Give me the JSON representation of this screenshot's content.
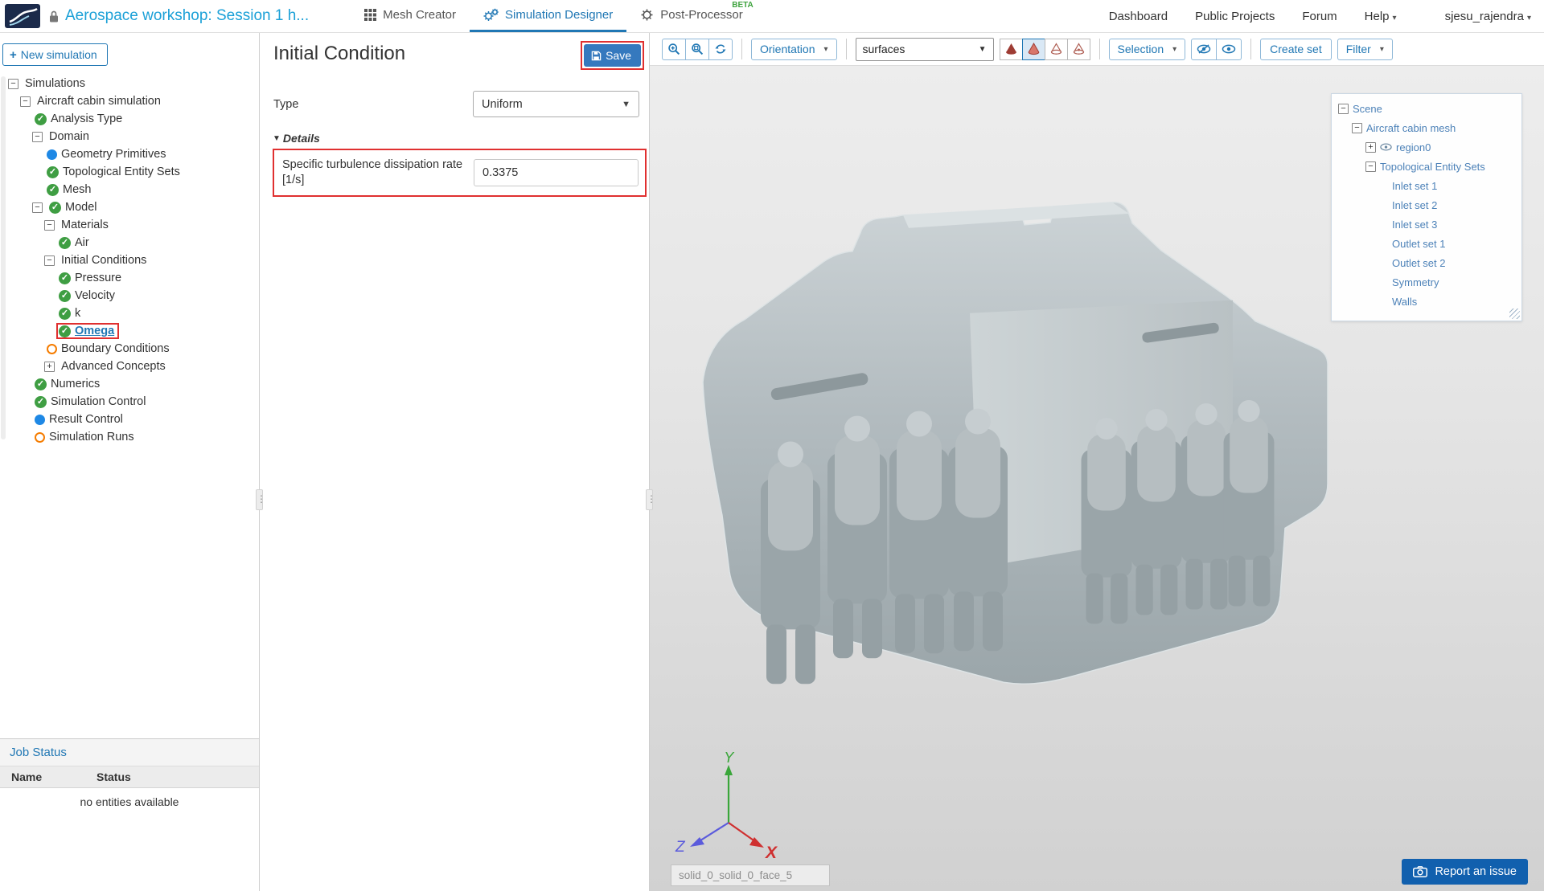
{
  "header": {
    "project_title": "Aerospace workshop: Session 1 h...",
    "tabs": [
      {
        "label": "Mesh Creator",
        "icon": "grid-icon",
        "active": false
      },
      {
        "label": "Simulation Designer",
        "icon": "gears-icon",
        "active": true
      },
      {
        "label": "Post-Processor",
        "icon": "gear-icon",
        "active": false,
        "badge": "BETA"
      }
    ],
    "nav_links": [
      "Dashboard",
      "Public Projects",
      "Forum"
    ],
    "help_label": "Help",
    "user_name": "sjesu_rajendra"
  },
  "sidebar": {
    "new_simulation_label": "New simulation",
    "tree": [
      {
        "label": "Simulations",
        "level": 0,
        "toggle": "minus"
      },
      {
        "label": "Aircraft cabin simulation",
        "level": 1,
        "toggle": "minus"
      },
      {
        "label": "Analysis Type",
        "level": 2,
        "status": "check"
      },
      {
        "label": "Domain",
        "level": 2,
        "toggle": "minus"
      },
      {
        "label": "Geometry Primitives",
        "level": 3,
        "status": "blue"
      },
      {
        "label": "Topological Entity Sets",
        "level": 3,
        "status": "check"
      },
      {
        "label": "Mesh",
        "level": 3,
        "status": "check"
      },
      {
        "label": "Model",
        "level": 2,
        "toggle": "minus",
        "status": "check"
      },
      {
        "label": "Materials",
        "level": 3,
        "toggle": "minus"
      },
      {
        "label": "Air",
        "level": 4,
        "status": "check"
      },
      {
        "label": "Initial Conditions",
        "level": 3,
        "toggle": "minus"
      },
      {
        "label": "Pressure",
        "level": 4,
        "status": "check"
      },
      {
        "label": "Velocity",
        "level": 4,
        "status": "check"
      },
      {
        "label": "k",
        "level": 4,
        "status": "check"
      },
      {
        "label": "Omega",
        "level": 4,
        "status": "check",
        "selected": true
      },
      {
        "label": "Boundary Conditions",
        "level": 3,
        "status": "orange"
      },
      {
        "label": "Advanced Concepts",
        "level": 3,
        "toggle": "plus"
      },
      {
        "label": "Numerics",
        "level": 2,
        "status": "check"
      },
      {
        "label": "Simulation Control",
        "level": 2,
        "status": "check"
      },
      {
        "label": "Result Control",
        "level": 2,
        "status": "blue"
      },
      {
        "label": "Simulation Runs",
        "level": 2,
        "status": "orange"
      }
    ],
    "job_status": {
      "title": "Job Status",
      "columns": [
        "Name",
        "Status"
      ],
      "empty_message": "no entities available"
    }
  },
  "panel": {
    "title": "Initial Condition",
    "save_label": "Save",
    "type_label": "Type",
    "type_value": "Uniform",
    "details_label": "Details",
    "field_label": "Specific turbulence dissipation rate [1/s]",
    "field_value": "0.3375"
  },
  "viewport": {
    "toolbar": {
      "orientation_label": "Orientation",
      "surfaces_value": "surfaces",
      "selection_label": "Selection",
      "create_set_label": "Create set",
      "filter_label": "Filter"
    },
    "scene_tree": [
      {
        "label": "Scene",
        "level": 0,
        "toggle": "minus"
      },
      {
        "label": "Aircraft cabin mesh",
        "level": 1,
        "toggle": "minus"
      },
      {
        "label": "region0",
        "level": 2,
        "toggle": "plus",
        "eye": true
      },
      {
        "label": "Topological Entity Sets",
        "level": 2,
        "toggle": "minus"
      },
      {
        "label": "Inlet set 1",
        "level": 3
      },
      {
        "label": "Inlet set 2",
        "level": 3
      },
      {
        "label": "Inlet set 3",
        "level": 3
      },
      {
        "label": "Outlet set 1",
        "level": 3
      },
      {
        "label": "Outlet set 2",
        "level": 3
      },
      {
        "label": "Symmetry",
        "level": 3
      },
      {
        "label": "Walls",
        "level": 3
      }
    ],
    "axis_labels": {
      "x": "X",
      "y": "Y",
      "z": "Z"
    },
    "face_field_value": "solid_0_solid_0_face_5",
    "report_issue_label": "Report an issue"
  },
  "colors": {
    "accent_blue": "#2077b4",
    "title_teal": "#1ba0d7",
    "save_blue": "#3579be",
    "highlight_red": "#e03030",
    "check_green": "#3f9e43",
    "dot_blue": "#1e88e5",
    "ring_orange": "#f57c00",
    "beta_green": "#3fa33f",
    "scene_tree_blue": "#4d82b8",
    "report_blue": "#1160ae"
  }
}
